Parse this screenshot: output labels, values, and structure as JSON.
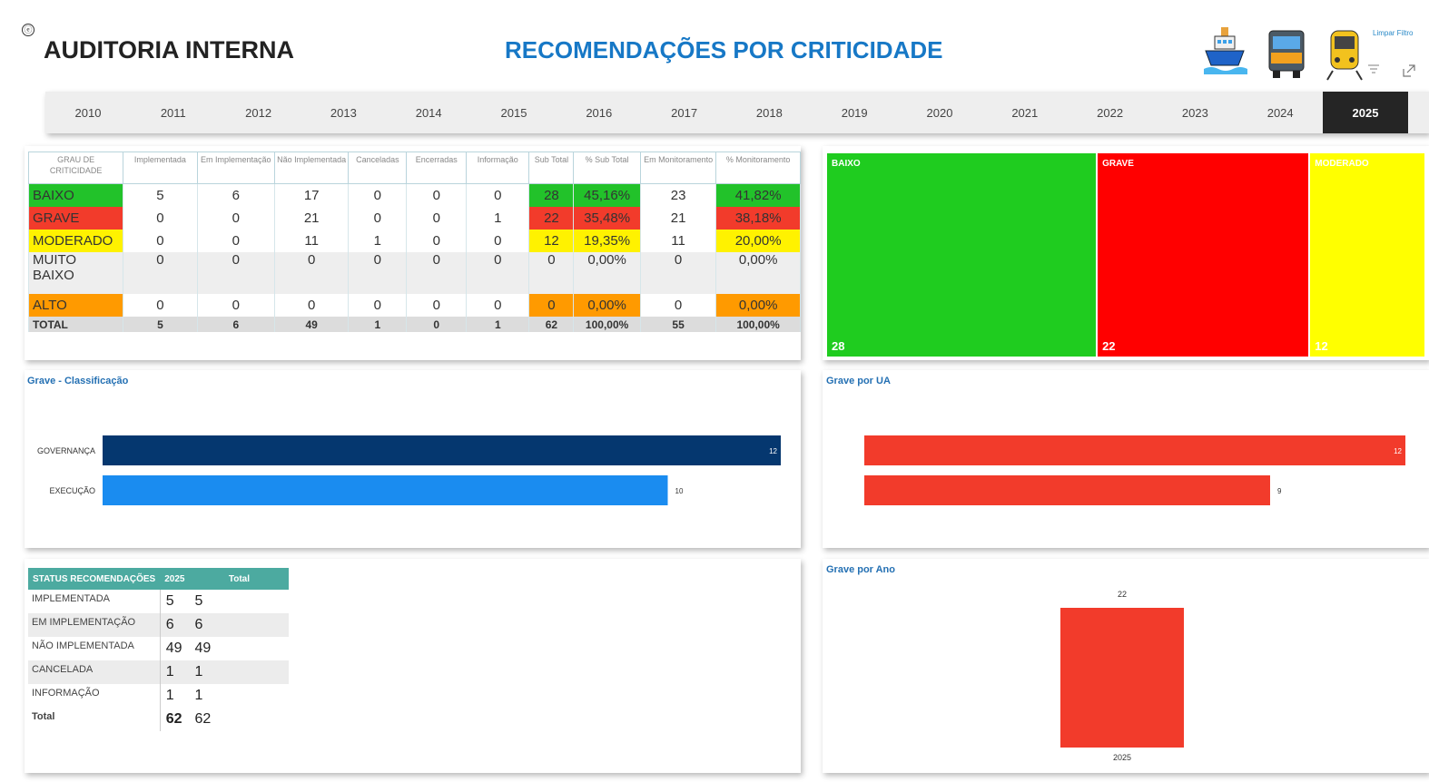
{
  "header": {
    "title": "AUDITORIA INTERNA",
    "subtitle": "RECOMENDAÇÕES POR CRITICIDADE",
    "info_icon": "ⓔ",
    "clear_filter": "Limpar Filtro",
    "icons": [
      "ship-icon",
      "truck-icon",
      "train-icon",
      "filter-icon",
      "expand-icon"
    ]
  },
  "years": [
    "2010",
    "2011",
    "2012",
    "2013",
    "2014",
    "2015",
    "2016",
    "2017",
    "2018",
    "2019",
    "2020",
    "2021",
    "2022",
    "2023",
    "2024",
    "2025"
  ],
  "selected_year": "2025",
  "crit_table": {
    "headers": [
      "GRAU DE CRITICIDADE",
      "Implementada",
      "Em Implementação",
      "Não Implementada",
      "Canceladas",
      "Encerradas",
      "Informação",
      "Sub Total",
      "% Sub Total",
      "Em Monitoramento",
      "% Monitoramento"
    ],
    "rows": [
      {
        "label": "BAIXO",
        "color": "#22c22a",
        "values": [
          "5",
          "6",
          "17",
          "0",
          "0",
          "0",
          "28",
          "45,16%",
          "23",
          "41,82%"
        ]
      },
      {
        "label": "GRAVE",
        "color": "#f23b2b",
        "values": [
          "0",
          "0",
          "21",
          "0",
          "0",
          "1",
          "22",
          "35,48%",
          "21",
          "38,18%"
        ]
      },
      {
        "label": "MODERADO",
        "color": "#fff200",
        "values": [
          "0",
          "0",
          "11",
          "1",
          "0",
          "0",
          "12",
          "19,35%",
          "11",
          "20,00%"
        ]
      },
      {
        "label": "MUITO BAIXO",
        "color": "",
        "values": [
          "0",
          "0",
          "0",
          "0",
          "0",
          "0",
          "0",
          "0,00%",
          "0",
          "0,00%"
        ]
      },
      {
        "label": "ALTO",
        "color": "#ff9a00",
        "values": [
          "0",
          "0",
          "0",
          "0",
          "0",
          "0",
          "0",
          "0,00%",
          "0",
          "0,00%"
        ]
      }
    ],
    "total": {
      "label": "TOTAL",
      "values": [
        "5",
        "6",
        "49",
        "1",
        "0",
        "1",
        "62",
        "100,00%",
        "55",
        "100,00%"
      ]
    }
  },
  "treemap": [
    {
      "label": "BAIXO",
      "value": "28",
      "color": "#1fcc1f"
    },
    {
      "label": "GRAVE",
      "value": "22",
      "color": "#ff0000"
    },
    {
      "label": "MODERADO",
      "value": "12",
      "color": "#ffff00"
    }
  ],
  "grave_classificacao": {
    "title": "Grave - Classificação",
    "chart_data": {
      "type": "bar",
      "orientation": "horizontal",
      "categories": [
        "GOVERNANÇA",
        "EXECUÇÃO"
      ],
      "values": [
        12,
        10
      ],
      "colors": [
        "#05376f",
        "#1a8cf0"
      ],
      "xlim": [
        0,
        12
      ]
    }
  },
  "grave_ua": {
    "title": "Grave por UA",
    "chart_data": {
      "type": "bar",
      "orientation": "horizontal",
      "categories": [
        "",
        ""
      ],
      "values": [
        12,
        9
      ],
      "colors": [
        "#f23b2b",
        "#f23b2b"
      ],
      "xlim": [
        0,
        12
      ]
    }
  },
  "status_table": {
    "headers": [
      "STATUS RECOMENDAÇÕES",
      "2025",
      "Total"
    ],
    "rows": [
      {
        "label": "IMPLEMENTADA",
        "y2025": "5",
        "total": "5"
      },
      {
        "label": "EM IMPLEMENTAÇÃO",
        "y2025": "6",
        "total": "6"
      },
      {
        "label": "NÃO IMPLEMENTADA",
        "y2025": "49",
        "total": "49"
      },
      {
        "label": "CANCELADA",
        "y2025": "1",
        "total": "1"
      },
      {
        "label": "INFORMAÇÃO",
        "y2025": "1",
        "total": "1"
      }
    ],
    "total": {
      "label": "Total",
      "y2025": "62",
      "total": "62"
    }
  },
  "grave_ano": {
    "title": "Grave por Ano",
    "chart_data": {
      "type": "bar",
      "categories": [
        "2025"
      ],
      "values": [
        22
      ],
      "colors": [
        "#f23b2b"
      ],
      "ylim": [
        0,
        22
      ]
    }
  }
}
